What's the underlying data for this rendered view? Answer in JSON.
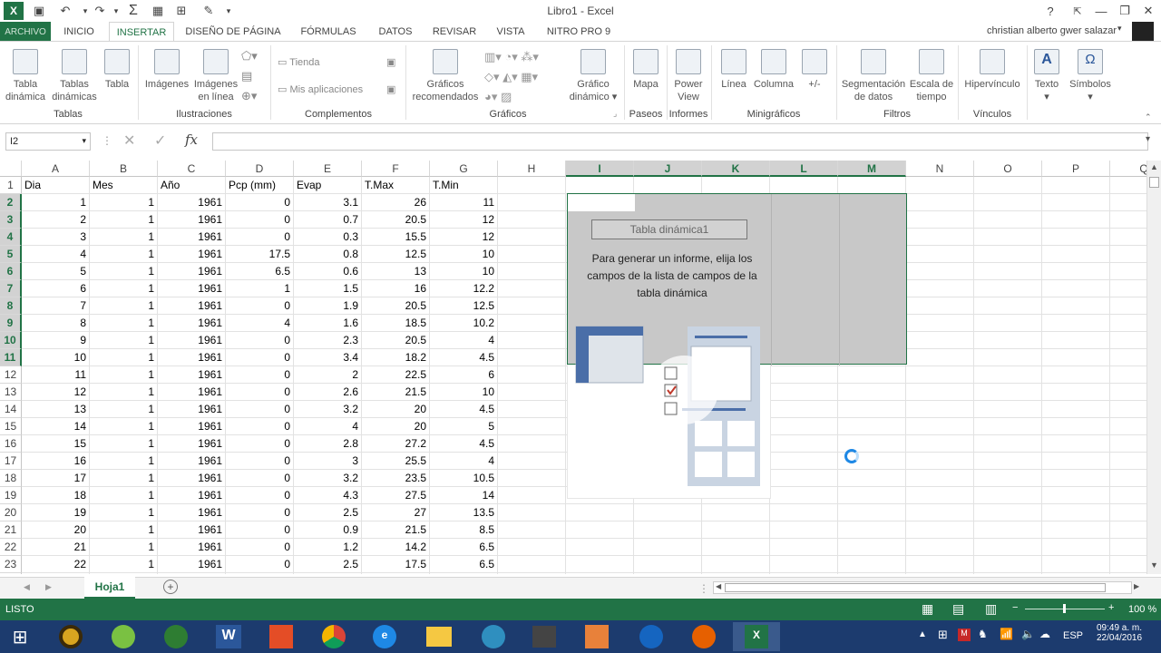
{
  "window": {
    "title": "Libro1 - Excel",
    "help": "?",
    "minimize": "—",
    "restore": "❐",
    "close": "✕"
  },
  "quick_access": [
    "save-icon",
    "undo-icon",
    "redo-icon",
    "autosum-icon",
    "table-icon",
    "border-icon",
    "paint-icon"
  ],
  "tabs": {
    "archivo": "ARCHIVO",
    "items": [
      "INICIO",
      "INSERTAR",
      "DISEÑO DE PÁGINA",
      "FÓRMULAS",
      "DATOS",
      "REVISAR",
      "VISTA",
      "NITRO PRO 9"
    ],
    "active": "INSERTAR"
  },
  "user": "christian alberto gwer salazar",
  "ribbon": {
    "tablas": {
      "group": "Tablas",
      "buttons": [
        [
          "Tabla",
          "dinámica"
        ],
        [
          "Tablas",
          "dinámicas"
        ],
        [
          "Tabla",
          ""
        ]
      ]
    },
    "ilustraciones": {
      "group": "Ilustraciones",
      "buttons": [
        [
          "Imágenes",
          ""
        ],
        [
          "Imágenes",
          "en línea"
        ]
      ]
    },
    "complementos": {
      "group": "Complementos",
      "tienda": "Tienda",
      "mis_apps": "Mis aplicaciones"
    },
    "graficos": {
      "group": "Gráficos",
      "recomendados": [
        "Gráficos",
        "recomendados"
      ],
      "dinamico": [
        "Gráfico",
        "dinámico ▾"
      ]
    },
    "paseos": {
      "group": "Paseos",
      "mapa": [
        "Mapa",
        ""
      ]
    },
    "informes": {
      "group": "Informes",
      "power": [
        "Power",
        "View"
      ]
    },
    "minigraficos": {
      "group": "Minigráficos",
      "linea": "Línea",
      "columna": "Columna",
      "pm": "+/-"
    },
    "filtros": {
      "group": "Filtros",
      "seg": [
        "Segmentación",
        "de datos"
      ],
      "escala": [
        "Escala de",
        "tiempo"
      ]
    },
    "vinculos": {
      "group": "Vínculos",
      "hiper": "Hipervínculo"
    },
    "texto": {
      "label": "Texto"
    },
    "simbolos": {
      "label": "Símbolos"
    }
  },
  "formula_bar": {
    "name_box": "I2",
    "fx": "fx",
    "value": ""
  },
  "columns": [
    "A",
    "B",
    "C",
    "D",
    "E",
    "F",
    "G",
    "H",
    "I",
    "J",
    "K",
    "L",
    "M",
    "N",
    "O",
    "P",
    "Q"
  ],
  "selected_columns": [
    "I",
    "J",
    "K",
    "L",
    "M"
  ],
  "selected_rows": [
    2,
    3,
    4,
    5,
    6,
    7,
    8,
    9,
    10,
    11
  ],
  "headers": [
    "Dia",
    "Mes",
    "Año",
    "Pcp (mm)",
    "Evap",
    "T.Max",
    "T.Min"
  ],
  "rows": [
    [
      1,
      1,
      1961,
      0,
      3.1,
      26,
      11
    ],
    [
      2,
      1,
      1961,
      0,
      0.7,
      20.5,
      12
    ],
    [
      3,
      1,
      1961,
      0,
      0.3,
      15.5,
      12
    ],
    [
      4,
      1,
      1961,
      17.5,
      0.8,
      12.5,
      10
    ],
    [
      5,
      1,
      1961,
      6.5,
      0.6,
      13,
      10
    ],
    [
      6,
      1,
      1961,
      1,
      1.5,
      16,
      12.2
    ],
    [
      7,
      1,
      1961,
      0,
      1.9,
      20.5,
      12.5
    ],
    [
      8,
      1,
      1961,
      4,
      1.6,
      18.5,
      10.2
    ],
    [
      9,
      1,
      1961,
      0,
      2.3,
      20.5,
      4
    ],
    [
      10,
      1,
      1961,
      0,
      3.4,
      18.2,
      4.5
    ],
    [
      11,
      1,
      1961,
      0,
      2,
      22.5,
      6
    ],
    [
      12,
      1,
      1961,
      0,
      2.6,
      21.5,
      10
    ],
    [
      13,
      1,
      1961,
      0,
      3.2,
      20,
      4.5
    ],
    [
      14,
      1,
      1961,
      0,
      4,
      20,
      5
    ],
    [
      15,
      1,
      1961,
      0,
      2.8,
      27.2,
      4.5
    ],
    [
      16,
      1,
      1961,
      0,
      3,
      25.5,
      4
    ],
    [
      17,
      1,
      1961,
      0,
      3.2,
      23.5,
      10.5
    ],
    [
      18,
      1,
      1961,
      0,
      4.3,
      27.5,
      14
    ],
    [
      19,
      1,
      1961,
      0,
      2.5,
      27,
      13.5
    ],
    [
      20,
      1,
      1961,
      0,
      0.9,
      21.5,
      8.5
    ],
    [
      21,
      1,
      1961,
      0,
      1.2,
      14.2,
      6.5
    ],
    [
      22,
      1,
      1961,
      0,
      2.5,
      17.5,
      6.5
    ]
  ],
  "pivot": {
    "name": "Tabla dinámica1",
    "message": "Para generar un informe, elija los campos de la lista de campos de la tabla dinámica"
  },
  "sheet_tab": "Hoja1",
  "status": {
    "ready": "LISTO",
    "zoom": "100 %"
  },
  "taskbar": {
    "lang": "ESP",
    "time": "09:49 a. m.",
    "date": "22/04/2016"
  },
  "colors": {
    "excel_green": "#217346",
    "selection_gray": "#c8c8c8",
    "taskbar": "#1c3b6e"
  }
}
